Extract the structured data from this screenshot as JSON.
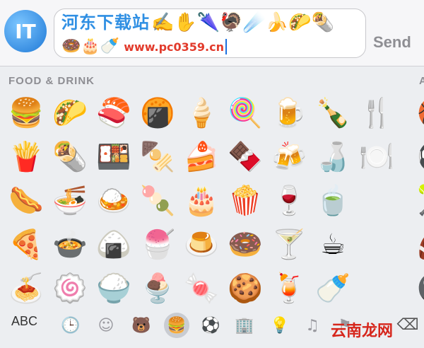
{
  "input_bar": {
    "logo_glyph": "IT",
    "draft_watermark_text": "河东下载站",
    "draft_emojis_row1": "✍️✋🌂🦃☄️🍌🌮🌯",
    "draft_emojis_row2": "🍩🎂🍼",
    "draft_watermark_url": "www.pc0359.cn",
    "send_label": "Send"
  },
  "keyboard": {
    "category_title": "FOOD & DRINK",
    "next_category_initial": "A",
    "emojis": [
      "🍔",
      "🌮",
      "🍣",
      "🍘",
      "🍦",
      "🍭",
      "🍺",
      "🍾",
      "🍴",
      "🍟",
      "🌯",
      "🍱",
      "🍢",
      "🍰",
      "🍫",
      "🍻",
      "🍶",
      "🍽️",
      "🌭",
      "🍜",
      "🍛",
      "🍡",
      "🎂",
      "🍿",
      "🍷",
      "🍵",
      "",
      "🍕",
      "🍲",
      "🍙",
      "🍧",
      "🍮",
      "🍩",
      "🍸",
      "☕",
      "",
      "🍝",
      "🍥",
      "🍚",
      "🍨",
      "🍬",
      "🍪",
      "🍹",
      "🍼",
      ""
    ],
    "peek_emojis": [
      "🏀",
      "⚽",
      "🎾",
      "🏈",
      "🎱"
    ]
  },
  "bottom_bar": {
    "abc_label": "ABC",
    "categories": [
      {
        "icon": "🕒",
        "name": "recent-icon"
      },
      {
        "icon": "☺",
        "name": "smiley-icon"
      },
      {
        "icon": "🐻",
        "name": "animal-icon"
      },
      {
        "icon": "🍔",
        "name": "food-icon"
      },
      {
        "icon": "⚽",
        "name": "activity-icon"
      },
      {
        "icon": "🏢",
        "name": "travel-icon"
      },
      {
        "icon": "💡",
        "name": "objects-icon"
      },
      {
        "icon": "♫",
        "name": "symbols-icon"
      },
      {
        "icon": "⚑",
        "name": "flags-icon"
      }
    ],
    "delete_icon": "⌫",
    "site_watermark": "云南龙网"
  }
}
